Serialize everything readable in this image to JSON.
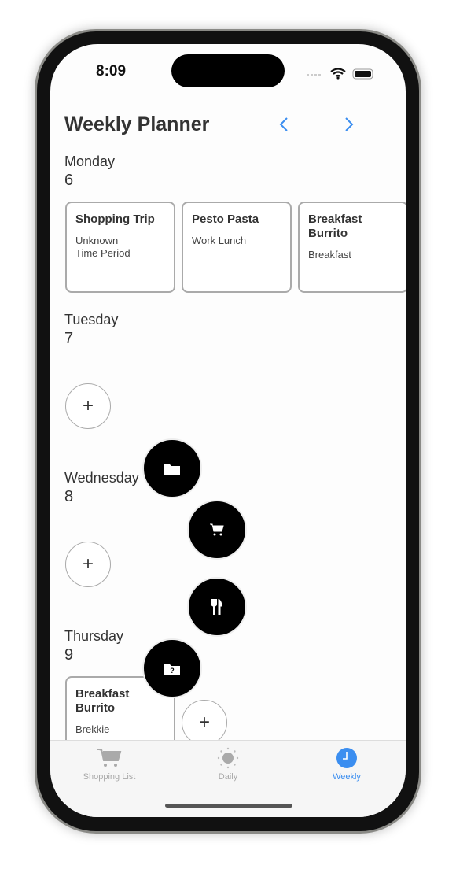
{
  "status": {
    "time": "8:09"
  },
  "header": {
    "title": "Weekly Planner",
    "prev_icon": "chevron-left-icon",
    "next_icon": "chevron-right-icon",
    "accent": "#3b8ef0"
  },
  "days": [
    {
      "name": "Monday",
      "date": "6",
      "cards": [
        {
          "title": "Shopping Trip",
          "subtitle": "Unknown Time Period"
        },
        {
          "title": "Pesto Pasta",
          "subtitle": "Work Lunch"
        },
        {
          "title": "Breakfast Burrito",
          "subtitle": "Breakfast"
        }
      ]
    },
    {
      "name": "Tuesday",
      "date": "7",
      "cards": []
    },
    {
      "name": "Wednesday",
      "date": "8",
      "cards": []
    },
    {
      "name": "Thursday",
      "date": "9",
      "cards": [
        {
          "title": "Breakfast Burrito",
          "subtitle": "Brekkie"
        }
      ]
    }
  ],
  "add_label": "+",
  "fab_menu": [
    {
      "icon": "folder-icon"
    },
    {
      "icon": "cart-icon"
    },
    {
      "icon": "fork-knife-icon"
    },
    {
      "icon": "folder-question-icon",
      "label": "?"
    }
  ],
  "tabs": [
    {
      "label": "Shopping List",
      "icon": "cart-icon"
    },
    {
      "label": "Daily",
      "icon": "sun-icon"
    },
    {
      "label": "Weekly",
      "icon": "clock-icon",
      "active": true
    }
  ]
}
